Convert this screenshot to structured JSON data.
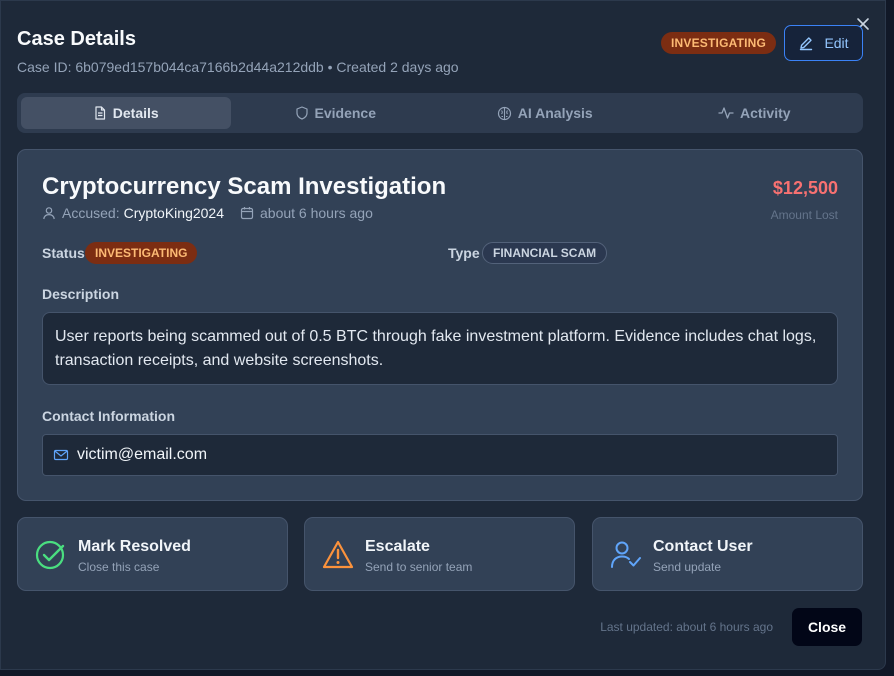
{
  "header": {
    "title": "Case Details",
    "case_id_line": "Case ID: 6b079ed157b044ca7166b2d44a212ddb • Created 2 days ago",
    "status_badge": "INVESTIGATING",
    "edit_label": "Edit",
    "close_icon": "close-icon"
  },
  "tabs": [
    {
      "label": "Details",
      "icon": "document-icon",
      "active": true
    },
    {
      "label": "Evidence",
      "icon": "shield-icon",
      "active": false
    },
    {
      "label": "AI Analysis",
      "icon": "brain-icon",
      "active": false
    },
    {
      "label": "Activity",
      "icon": "activity-icon",
      "active": false
    }
  ],
  "case": {
    "title": "Cryptocurrency Scam Investigation",
    "accused_label": "Accused:",
    "accused_name": "CryptoKing2024",
    "time": "about 6 hours ago",
    "amount": "$12,500",
    "amount_label": "Amount Lost",
    "status_label": "Status",
    "status_value": "INVESTIGATING",
    "type_label": "Type",
    "type_value": "FINANCIAL SCAM",
    "description_label": "Description",
    "description": "User reports being scammed out of 0.5 BTC through fake investment platform. Evidence includes chat logs, transaction receipts, and website screenshots.",
    "contact_label": "Contact Information",
    "contact_email": "victim@email.com"
  },
  "actions": [
    {
      "title": "Mark Resolved",
      "subtitle": "Close this case",
      "icon": "check-circle-icon",
      "color": "#4ade80"
    },
    {
      "title": "Escalate",
      "subtitle": "Send to senior team",
      "icon": "warning-icon",
      "color": "#fb923c"
    },
    {
      "title": "Contact User",
      "subtitle": "Send update",
      "icon": "user-check-icon",
      "color": "#60a5fa"
    }
  ],
  "footer": {
    "last_updated": "Last updated: about 6 hours ago",
    "close_label": "Close"
  },
  "colors": {
    "status_bg": "#7c2d12",
    "status_text": "#fdba74",
    "amount": "#f87171",
    "accent": "#3b82f6"
  }
}
